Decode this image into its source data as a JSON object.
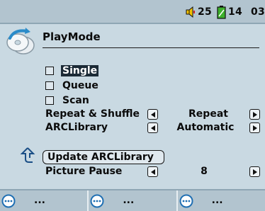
{
  "status": {
    "volume": "25",
    "battery": "14",
    "time": "03"
  },
  "header": {
    "title": "PlayMode"
  },
  "options": [
    {
      "label": "Single",
      "checked": false,
      "selected": true
    },
    {
      "label": "Queue",
      "checked": false,
      "selected": false
    },
    {
      "label": "Scan",
      "checked": false,
      "selected": false
    }
  ],
  "settings": {
    "repeat_shuffle": {
      "label": "Repeat & Shuffle",
      "value": "Repeat"
    },
    "arclibrary": {
      "label": "ARCLibrary",
      "value": "Automatic"
    },
    "picture_pause": {
      "label": "Picture Pause",
      "value": "8"
    }
  },
  "update_button": {
    "label": "Update ARCLibrary"
  },
  "softkeys": [
    {
      "label": "..."
    },
    {
      "label": "..."
    },
    {
      "label": "..."
    }
  ],
  "colors": {
    "background": "#c9d9e2",
    "bar": "#b2c4cf",
    "icon_blue": "#2a8bc9",
    "battery_green": "#3db02c"
  }
}
